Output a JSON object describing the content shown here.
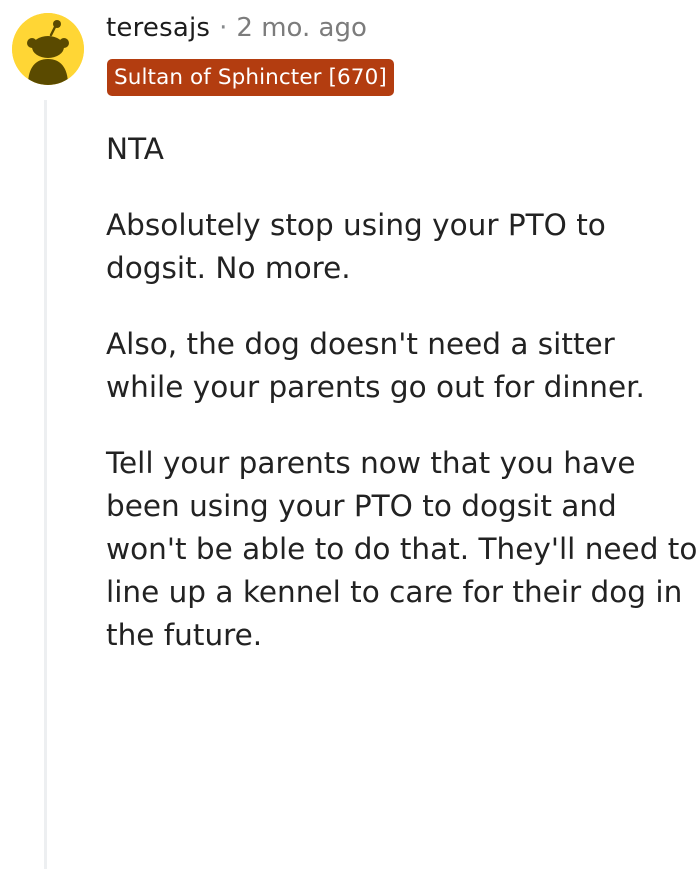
{
  "comment": {
    "author": "teresajs",
    "separator": "·",
    "time_ago": "2 mo. ago",
    "flair": "Sultan of Sphincter [670]",
    "paragraphs": [
      "NTA",
      "Absolutely stop using your PTO to dogsit. No more.",
      "Also, the dog doesn't need a sitter while your parents go out for dinner.",
      "Tell your parents now that you have been using your PTO to dogsit and won't be able to do that. They'll need to line up a kennel to care for their dog in the future."
    ]
  },
  "colors": {
    "avatar_bg": "#ffd635",
    "flair_bg": "#b33d10",
    "flair_text": "#ffffff",
    "thread_line": "#edeff1"
  },
  "icons": {
    "avatar": "snoo-avatar-icon"
  }
}
